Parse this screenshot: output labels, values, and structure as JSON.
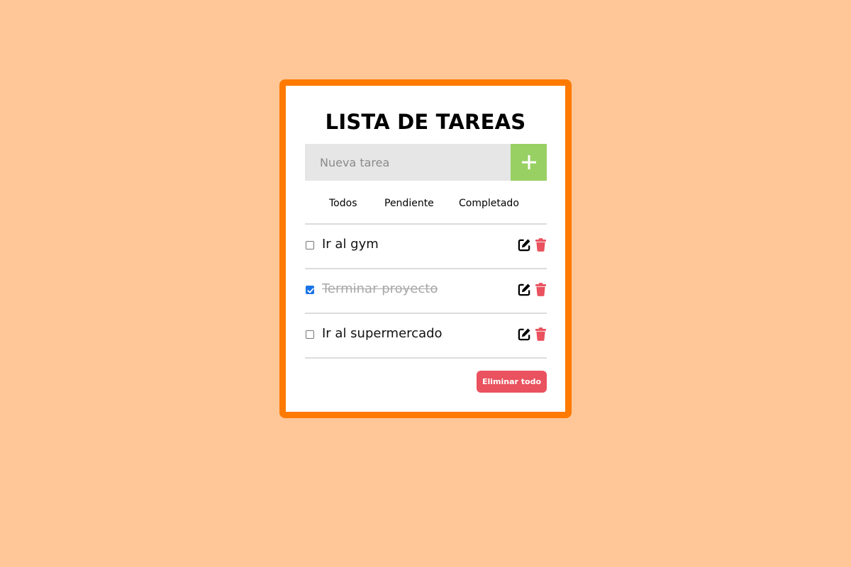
{
  "header": {
    "title": "LISTA DE TAREAS"
  },
  "new_task": {
    "placeholder": "Nueva tarea",
    "value": "",
    "add_icon": "plus-icon"
  },
  "filters": [
    {
      "label": "Todos"
    },
    {
      "label": "Pendiente"
    },
    {
      "label": "Completado"
    }
  ],
  "tasks": [
    {
      "label": "Ir al gym",
      "completed": false
    },
    {
      "label": "Terminar proyecto",
      "completed": true
    },
    {
      "label": "Ir al supermercado",
      "completed": false
    }
  ],
  "actions": {
    "delete_all_label": "Eliminar todo"
  },
  "colors": {
    "background": "#ffc698",
    "card_border": "#ff7a00",
    "add_button": "#98d063",
    "delete": "#e9525e",
    "checkbox_checked": "#1a73e8"
  },
  "icons": {
    "edit": "edit-icon",
    "delete": "trash-icon"
  }
}
